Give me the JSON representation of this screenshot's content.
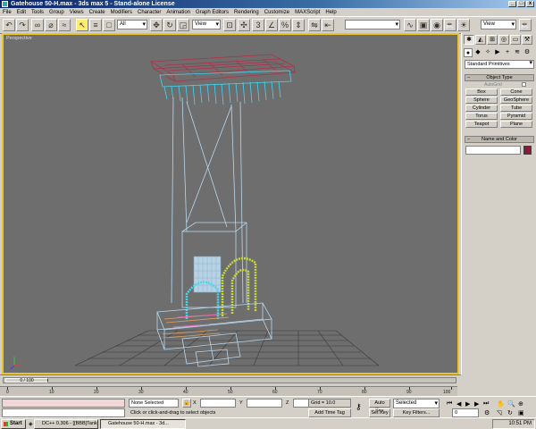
{
  "window": {
    "title": "Gatehouse 50-H.max - 3ds max 5 - Stand-alone License",
    "minimize": "_",
    "maximize": "□",
    "close": "x"
  },
  "menu": [
    "File",
    "Edit",
    "Tools",
    "Group",
    "Views",
    "Create",
    "Modifiers",
    "Character",
    "Animation",
    "Graph Editors",
    "Rendering",
    "Customize",
    "MAXScript",
    "Help"
  ],
  "toolbar": {
    "selection_filter": "All",
    "coord_system": "View",
    "named_selection": "",
    "view_dropdown": "View"
  },
  "viewport": {
    "label": "Perspective"
  },
  "command_panel": {
    "category_dropdown": "Standard Primitives",
    "object_type_title": "Object Type",
    "autogrid_label": "AutoGrid",
    "primitives": [
      "Box",
      "Cone",
      "Sphere",
      "GeoSphere",
      "Cylinder",
      "Tube",
      "Torus",
      "Pyramid",
      "Teapot",
      "Plane"
    ],
    "name_color_title": "Name and Color",
    "name_value": "",
    "object_color": "#8a1a3c"
  },
  "timeline": {
    "thumb_label": "0 / 100",
    "ticks": [
      "0",
      "10",
      "20",
      "30",
      "40",
      "50",
      "60",
      "70",
      "80",
      "90",
      "100"
    ]
  },
  "status": {
    "selection": "None Selected",
    "prompt": "Click or click-and-drag to select objects",
    "x_label": "X",
    "y_label": "Y",
    "z_label": "Z",
    "x_value": "",
    "y_value": "",
    "z_value": "",
    "grid": "Grid = 10.0",
    "add_time_tag": "Add Time Tag",
    "auto_key": "Auto Key",
    "set_key": "Set Key",
    "key_filter_dropdown": "Selected",
    "key_filters": "Key Filters...",
    "frame": "0"
  },
  "taskbar": {
    "start": "Start",
    "tasks": [
      "DC++ 0.306 - [[BBB]Tank...",
      "Gatehouse 50-H.max - 3d..."
    ],
    "clock": "10:51 PM"
  }
}
